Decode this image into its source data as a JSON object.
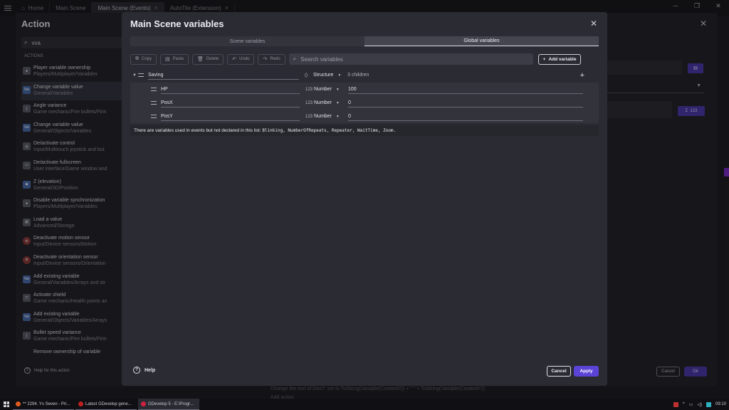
{
  "topbar": {
    "tabs": [
      {
        "label": "Home",
        "active": false
      },
      {
        "label": "Main Scene",
        "active": false
      },
      {
        "label": "Main Scene (Events)",
        "active": true
      },
      {
        "label": "AutoTile (Extension)",
        "active": false
      }
    ],
    "tab_close_glyph": "×",
    "window_controls": [
      "─",
      "❐",
      "✕"
    ]
  },
  "action_dialog": {
    "title": "Action",
    "search_value": "vva",
    "section_header": "ACTIONS",
    "items": [
      {
        "name": "Player variable ownership",
        "category": "Players/Multiplayer/Variables",
        "icon": "person-icon",
        "selected": false
      },
      {
        "name": "Change variable value",
        "category": "General/Variables",
        "icon": "variable-icon",
        "selected": true
      },
      {
        "name": "Angle variance",
        "category": "Game mechanic/Fire bullets/Firin",
        "icon": "bullet-icon",
        "selected": false
      },
      {
        "name": "Change variable value",
        "category": "General/Objects/Variables",
        "icon": "variable-icon",
        "selected": false
      },
      {
        "name": "De/activate control",
        "category": "Input/Multitouch joystick and but",
        "icon": "joystick-icon",
        "selected": false
      },
      {
        "name": "De/activate fullscreen",
        "category": "User interface/Game window and",
        "icon": "window-icon",
        "selected": false
      },
      {
        "name": "Z (elevation)",
        "category": "General/3D/Position",
        "icon": "cube-icon",
        "selected": false
      },
      {
        "name": "Disable variable synchronization",
        "category": "Players/Multiplayer/Variables",
        "icon": "person-icon",
        "selected": false
      },
      {
        "name": "Load a value",
        "category": "Advanced/Storage",
        "icon": "storage-icon",
        "selected": false
      },
      {
        "name": "Deactivate motion sensor",
        "category": "Input/Device sensors/Motion",
        "icon": "sensor-icon",
        "selected": false
      },
      {
        "name": "Deactivate orientation sensor",
        "category": "Input/Device sensors/Orientation",
        "icon": "sensor-icon",
        "selected": false
      },
      {
        "name": "Add existing variable",
        "category": "General/Variables/Arrays and str",
        "icon": "variable-icon",
        "selected": false
      },
      {
        "name": "Activate shield",
        "category": "Game mechanic/Health points an",
        "icon": "shield-icon",
        "selected": false
      },
      {
        "name": "Add existing variable",
        "category": "General/Objects/Variables/Arrays",
        "icon": "variable-icon",
        "selected": false
      },
      {
        "name": "Bullet speed variance",
        "category": "Game mechanic/Fire bullets/Firin",
        "icon": "bullet-icon",
        "selected": false
      },
      {
        "name": "Remove ownership of variable",
        "category": "",
        "icon": "person-icon",
        "selected": false
      }
    ],
    "help_label": "Help for this action",
    "cancel_label": "Cancel",
    "ok_label": "Ok",
    "expression_badge": "123",
    "events_line1": "Change the text of  DexY: set to ToString(Variable(CreatedX)) + \" \" + ToString(Variable(CreatedY))",
    "events_line2": "Add action"
  },
  "modal": {
    "title": "Main Scene variables",
    "tabs": [
      {
        "label": "Scene variables",
        "active": false
      },
      {
        "label": "Global variables",
        "active": true
      }
    ],
    "toolbar": {
      "copy": "Copy",
      "paste": "Paste",
      "delete": "Delete",
      "undo": "Undo",
      "redo": "Redo",
      "search_placeholder": "Search variables",
      "add_variable": "Add variable"
    },
    "variables": [
      {
        "name": "Saving",
        "type": "Structure",
        "type_icon": "()",
        "value": "3 children",
        "is_parent": true
      },
      {
        "name": "HP",
        "type": "Number",
        "type_icon": "123",
        "value": "100",
        "is_parent": false
      },
      {
        "name": "PosX",
        "type": "Number",
        "type_icon": "123",
        "value": "0",
        "is_parent": false
      },
      {
        "name": "PosY",
        "type": "Number",
        "type_icon": "123",
        "value": "0",
        "is_parent": false
      }
    ],
    "warning_prefix": "There are variables used in events but not declared in this list:",
    "undeclared": "Blinking, NumberOfRepeats, Repeater, WaitTime, Zoom.",
    "help_label": "Help",
    "cancel_label": "Cancel",
    "apply_label": "Apply"
  },
  "taskbar": {
    "apps": [
      {
        "label": "** 2294. Ys Seven - Pri...",
        "color": "#e05a20",
        "active": false
      },
      {
        "label": "Latest GDevelop gene...",
        "color": "#c02020",
        "active": false
      },
      {
        "label": "GDevelop 5 - E:\\Progr...",
        "color": "#d02040",
        "active": true
      }
    ],
    "clock": "09:10"
  },
  "colors": {
    "accent": "#5b43d6",
    "modal_bg": "#2b2b33",
    "page_bg": "#1e1e24"
  }
}
